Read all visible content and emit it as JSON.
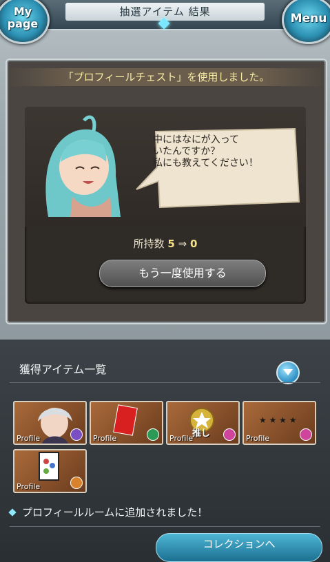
{
  "header": {
    "title": "抽選アイテム 結果",
    "mypage_line1": "My",
    "mypage_line2": "page",
    "menu_label": "Menu"
  },
  "panel": {
    "title": "「プロフィールチェスト」を使用しました。",
    "speech": [
      "中にはなにが入って",
      "いたんですか？",
      "私にも教えてください！"
    ],
    "count_label": "所持数",
    "count_before": "5",
    "count_arrow": "⇒",
    "count_after": "0",
    "use_again_label": "もう一度使用する"
  },
  "items_section": {
    "title": "獲得アイテム一覧",
    "items": [
      {
        "label": "Profile",
        "badge_color": "#7a4fc1",
        "icon": "character-portrait-icon"
      },
      {
        "label": "Profile",
        "badge_color": "#2c9a56",
        "icon": "red-card-icon"
      },
      {
        "label": "Profile",
        "badge_color": "#d0459c",
        "icon": "star-oshi-icon",
        "text": "推し"
      },
      {
        "label": "Profile",
        "badge_color": "#d0459c",
        "icon": "sparkle-stars-icon"
      },
      {
        "label": "Profile",
        "badge_color": "#d8822b",
        "icon": "framed-card-icon"
      }
    ]
  },
  "notice": {
    "text": "プロフィールルームに追加されました！"
  },
  "collection_button": {
    "label": "コレクションへ"
  }
}
